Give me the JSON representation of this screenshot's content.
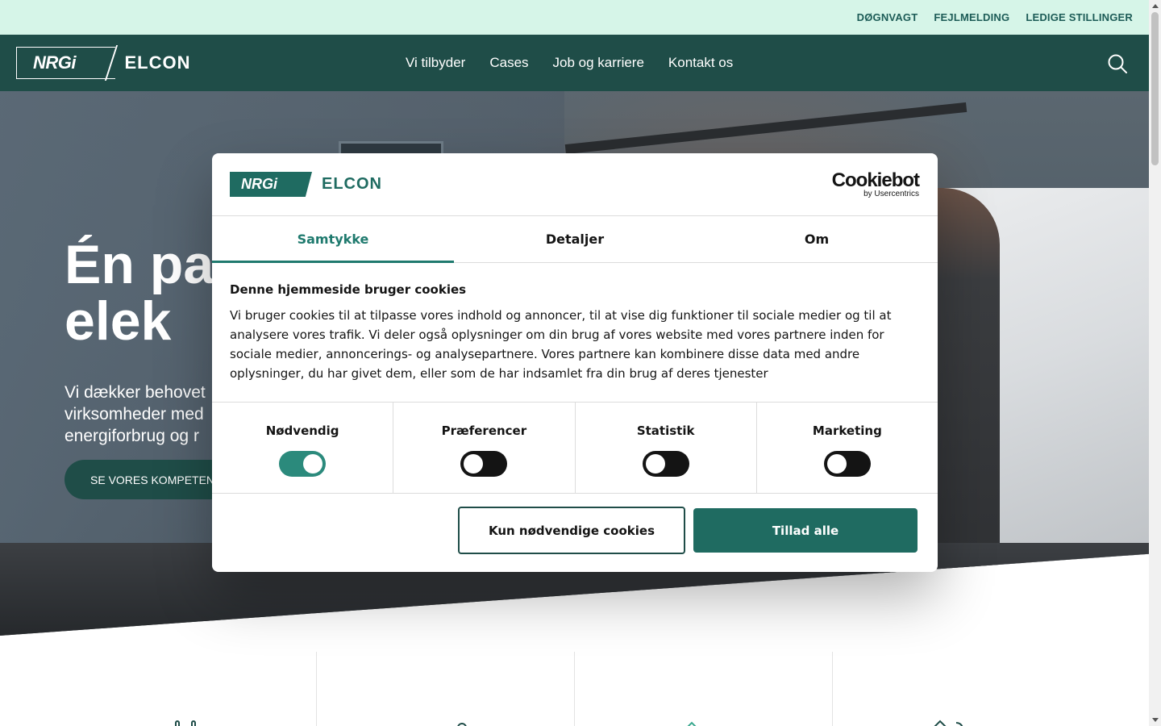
{
  "topbar": {
    "links": [
      "DØGNVAGT",
      "FEJLMELDING",
      "LEDIGE STILLINGER"
    ]
  },
  "header": {
    "logo_nrgi": "NRGi",
    "logo_elcon": "ELCON",
    "nav": [
      "Vi tilbyder",
      "Cases",
      "Job og karriere",
      "Kontakt os"
    ],
    "search_icon": "search-icon"
  },
  "hero": {
    "title": "Én pa\nelek",
    "text": "Vi dækker behovet\nvirksomheder med\nenergiforbrug og r",
    "cta": "SE VORES KOMPETEN"
  },
  "cookie_dialog": {
    "logo_nrgi": "NRGi",
    "logo_elcon": "ELCON",
    "cookiebot": "Cookiebot",
    "cookiebot_sub": "by Usercentrics",
    "tabs": [
      {
        "label": "Samtykke",
        "active": true
      },
      {
        "label": "Detaljer",
        "active": false
      },
      {
        "label": "Om",
        "active": false
      }
    ],
    "title": "Denne hjemmeside bruger cookies",
    "text": "Vi bruger cookies til at tilpasse vores indhold og annoncer, til at vise dig funktioner til sociale medier og til at analysere vores trafik. Vi deler også oplysninger om din brug af vores website med vores partnere inden for sociale medier, annoncerings- og analysepartnere. Vores partnere kan kombinere disse data med andre oplysninger, du har givet dem, eller som de har indsamlet fra din brug af deres tjenester",
    "consents": [
      {
        "label": "Nødvendig",
        "on": true
      },
      {
        "label": "Præferencer",
        "on": false
      },
      {
        "label": "Statistik",
        "on": false
      },
      {
        "label": "Marketing",
        "on": false
      }
    ],
    "btn_necessary": "Kun nødvendige cookies",
    "btn_all": "Tillad alle"
  },
  "colors": {
    "brand_dark": "#1f4d48",
    "brand": "#1f6b61",
    "accent": "#1f7a6e",
    "topbar_bg": "#d6f5e8"
  }
}
